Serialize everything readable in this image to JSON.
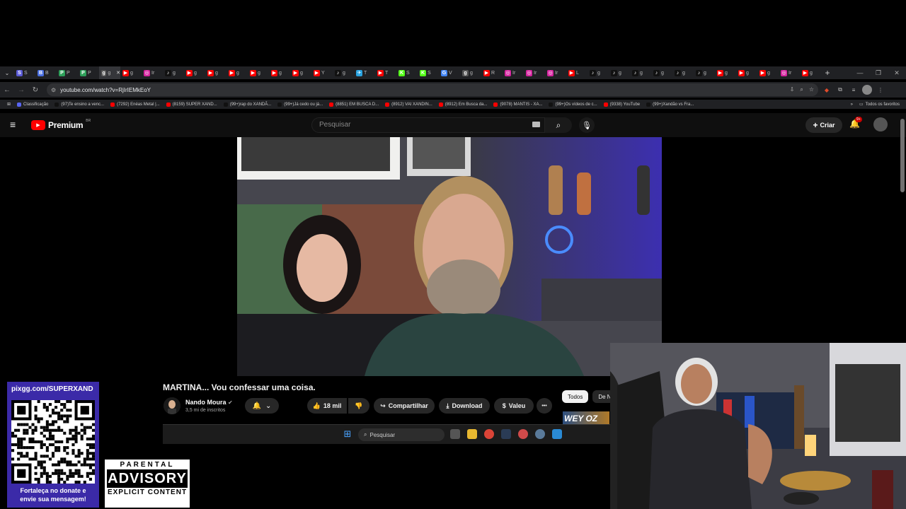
{
  "browser": {
    "tabs": [
      {
        "fav": "S",
        "color": "#5b5bd6",
        "label": "S"
      },
      {
        "fav": "B",
        "color": "#4a6fe0",
        "label": "B"
      },
      {
        "fav": "P",
        "color": "#2ea05a",
        "label": "P"
      },
      {
        "fav": "P",
        "color": "#2ea05a",
        "label": "P"
      },
      {
        "fav": "g",
        "color": "#555555",
        "label": "g"
      },
      {
        "fav": "▶",
        "color": "#ff0000",
        "label": "g"
      },
      {
        "fav": "◎",
        "color": "#d6249f",
        "label": "Ir"
      },
      {
        "fav": "♪",
        "color": "#111111",
        "label": "g"
      },
      {
        "fav": "▶",
        "color": "#ff0000",
        "label": "g"
      },
      {
        "fav": "▶",
        "color": "#ff0000",
        "label": "g"
      },
      {
        "fav": "▶",
        "color": "#ff0000",
        "label": "g"
      },
      {
        "fav": "▶",
        "color": "#ff0000",
        "label": "g"
      },
      {
        "fav": "▶",
        "color": "#ff0000",
        "label": "g"
      },
      {
        "fav": "▶",
        "color": "#ff0000",
        "label": "g"
      },
      {
        "fav": "▶",
        "color": "#ff0000",
        "label": "Y"
      },
      {
        "fav": "♪",
        "color": "#111111",
        "label": "g"
      },
      {
        "fav": "✈",
        "color": "#2aa3e0",
        "label": "T"
      },
      {
        "fav": "▶",
        "color": "#ff0000",
        "label": "T"
      },
      {
        "fav": "K",
        "color": "#53fc18",
        "label": "S"
      },
      {
        "fav": "K",
        "color": "#53fc18",
        "label": "S"
      },
      {
        "fav": "G",
        "color": "#4285f4",
        "label": "V"
      },
      {
        "fav": "g",
        "color": "#555555",
        "label": "g"
      },
      {
        "fav": "▶",
        "color": "#ff0000",
        "label": "R"
      },
      {
        "fav": "◎",
        "color": "#d6249f",
        "label": "Ir"
      },
      {
        "fav": "◎",
        "color": "#d6249f",
        "label": "Ir"
      },
      {
        "fav": "◎",
        "color": "#d6249f",
        "label": "Ir"
      },
      {
        "fav": "▶",
        "color": "#ff0000",
        "label": "L"
      },
      {
        "fav": "♪",
        "color": "#111111",
        "label": "g"
      },
      {
        "fav": "♪",
        "color": "#111111",
        "label": "g"
      },
      {
        "fav": "♪",
        "color": "#111111",
        "label": "g"
      },
      {
        "fav": "♪",
        "color": "#111111",
        "label": "g"
      },
      {
        "fav": "♪",
        "color": "#111111",
        "label": "g"
      },
      {
        "fav": "♪",
        "color": "#111111",
        "label": "g"
      },
      {
        "fav": "▶",
        "color": "#ff0000",
        "label": "g"
      },
      {
        "fav": "▶",
        "color": "#ff0000",
        "label": "g"
      },
      {
        "fav": "▶",
        "color": "#ff0000",
        "label": "g"
      },
      {
        "fav": "◎",
        "color": "#d6249f",
        "label": "Ir"
      },
      {
        "fav": "▶",
        "color": "#ff0000",
        "label": "g"
      }
    ],
    "url": "youtube.com/watch?v=RjIrIEMkEoY",
    "bookmarks": [
      {
        "label": "Classificação",
        "color": "#5865f2"
      },
      {
        "label": "(97)Te ensino a venc...",
        "color": "#111111"
      },
      {
        "label": "(7292) Enéas Metal |...",
        "color": "#ff0000"
      },
      {
        "label": "(8159) SUPER XAND...",
        "color": "#ff0000"
      },
      {
        "label": "(99+)rap do XANDÃ...",
        "color": "#111111"
      },
      {
        "label": "(99+)Já cedo ou já...",
        "color": "#111111"
      },
      {
        "label": "(8851) EM BUSCA D...",
        "color": "#ff0000"
      },
      {
        "label": "(8912) VAI XANDIN...",
        "color": "#ff0000"
      },
      {
        "label": "(8912) Em Busca da...",
        "color": "#ff0000"
      },
      {
        "label": "(9078) MANTIS - XA...",
        "color": "#ff0000"
      },
      {
        "label": "(99+)Os vídeos de c...",
        "color": "#111111"
      },
      {
        "label": "(9338) YouTube",
        "color": "#ff0000"
      },
      {
        "label": "(99+)Xandão vs Fra...",
        "color": "#111111"
      }
    ],
    "all_bookmarks": "Todos os favoritos"
  },
  "youtube": {
    "logo": "Premium",
    "region": "BR",
    "search_placeholder": "Pesquisar",
    "create_label": "Criar",
    "notif_count": "9+",
    "video_title": "MARTINA... Vou confessar uma coisa.",
    "channel_name": "Nando Moura",
    "subscribers": "3,5 mi de inscritos",
    "likes": "18 mil",
    "share_label": "Compartilhar",
    "download_label": "Download",
    "thanks_label": "Valeu",
    "more_label": "•••",
    "chips": [
      "Todos",
      "De N"
    ],
    "thumb_text": "WEY OZ"
  },
  "taskbar": {
    "search_placeholder": "Pesquisar"
  },
  "overlay": {
    "qr_url": "pixgg.com/SUPERXAND",
    "qr_caption_line1": "Fortaleça no donate e",
    "qr_caption_line2": "envie sua mensagem!",
    "advisory_top": "PARENTAL",
    "advisory_mid": "ADVISORY",
    "advisory_bottom": "EXPLICIT CONTENT"
  }
}
